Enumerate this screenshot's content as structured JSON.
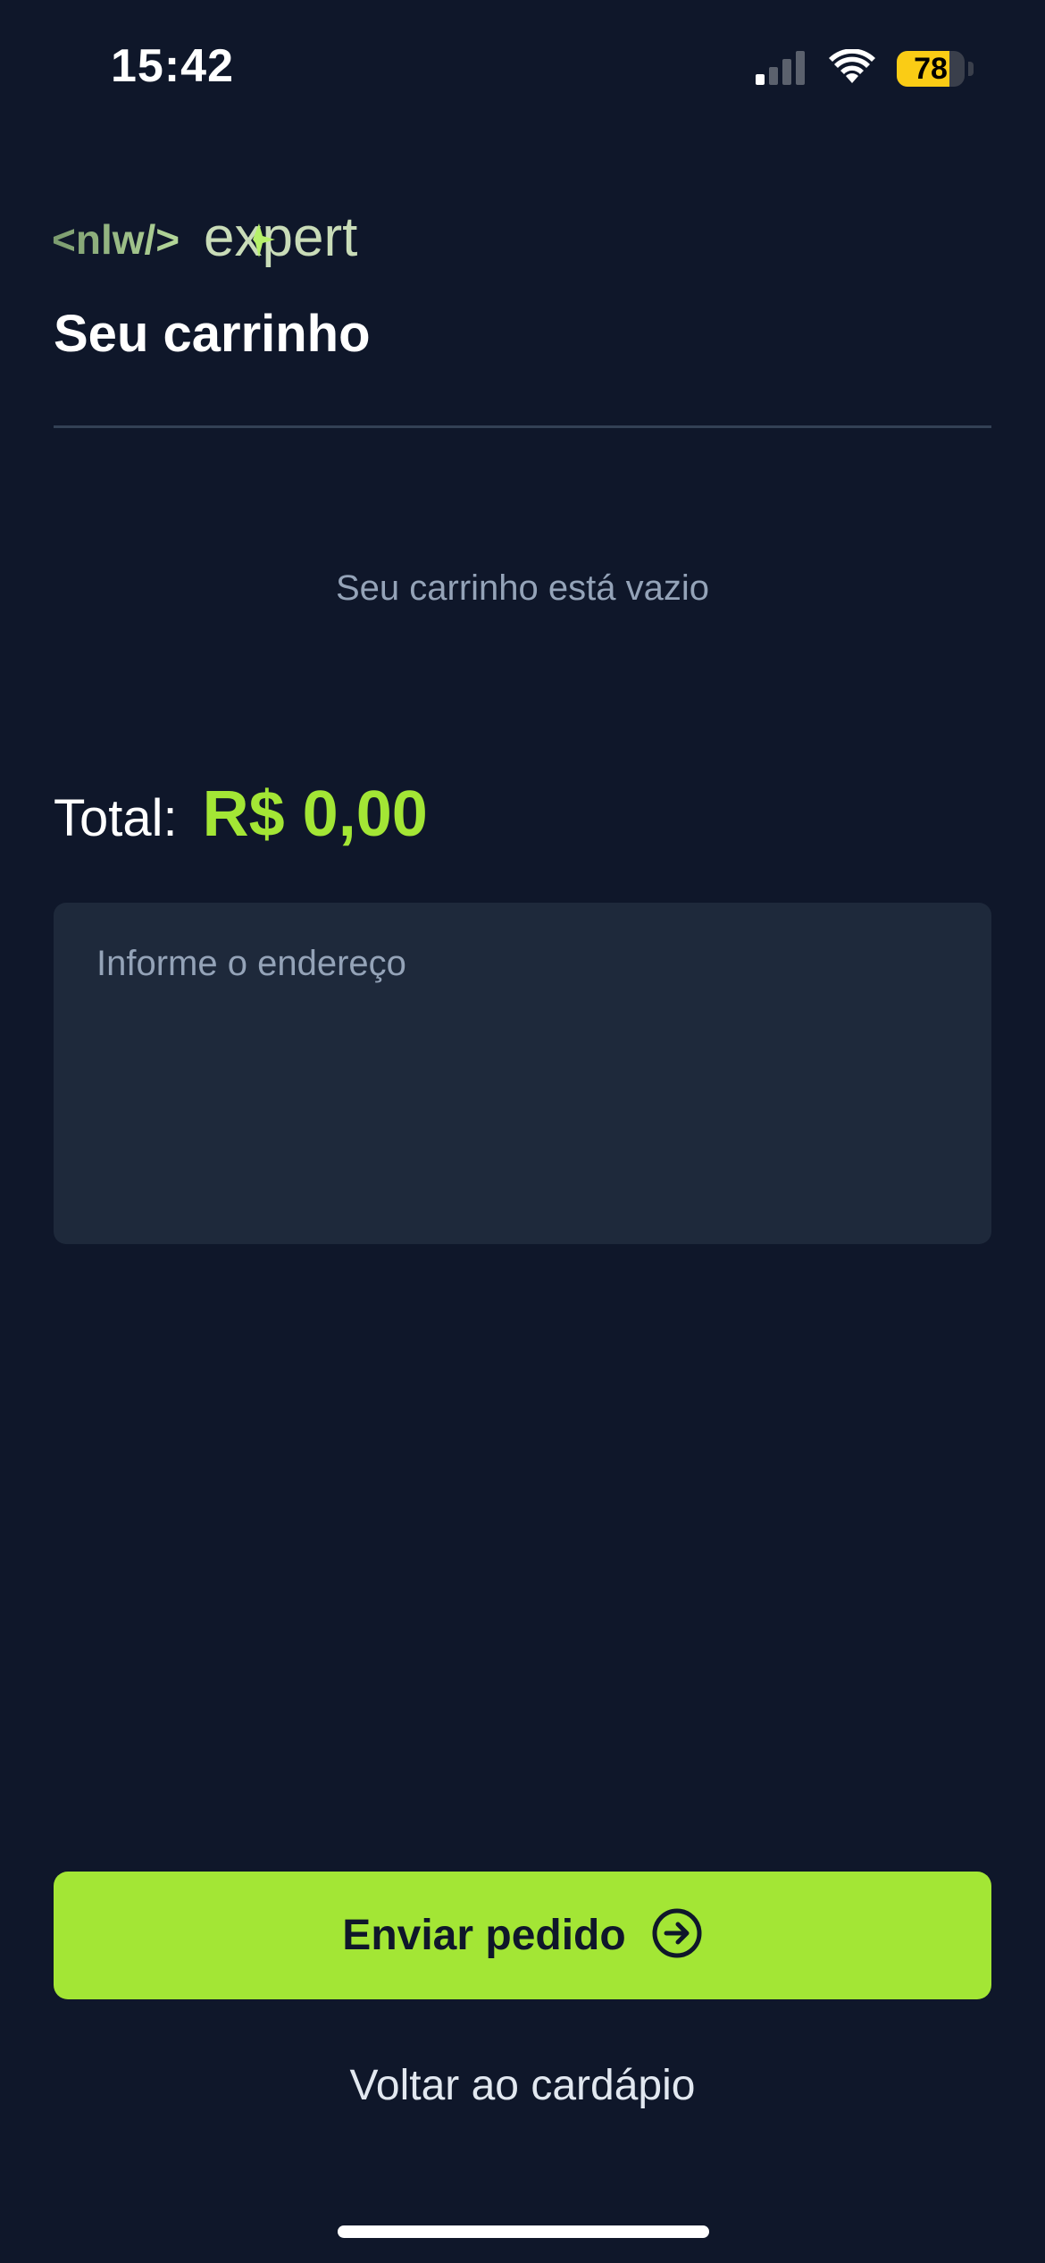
{
  "status_bar": {
    "time": "15:42",
    "battery_level": "78",
    "battery_fraction": 0.78,
    "icons": [
      "signal-icon",
      "wifi-icon",
      "battery-icon"
    ]
  },
  "header": {
    "logo_brand": "<nlw/>",
    "logo_word": "expert",
    "title": "Seu carrinho"
  },
  "cart": {
    "empty_message": "Seu carrinho está vazio",
    "total_label": "Total:",
    "total_value": "R$ 0,00"
  },
  "address": {
    "placeholder": "Informe o endereço",
    "value": ""
  },
  "actions": {
    "send_label": "Enviar pedido",
    "send_icon": "arrow-circle-right-icon",
    "back_label": "Voltar ao cardápio"
  },
  "colors": {
    "background": "#0f172a",
    "accent": "#a3e635",
    "input_bg": "#1e293b",
    "muted_text": "#94a3b8",
    "battery": "#facc15"
  }
}
